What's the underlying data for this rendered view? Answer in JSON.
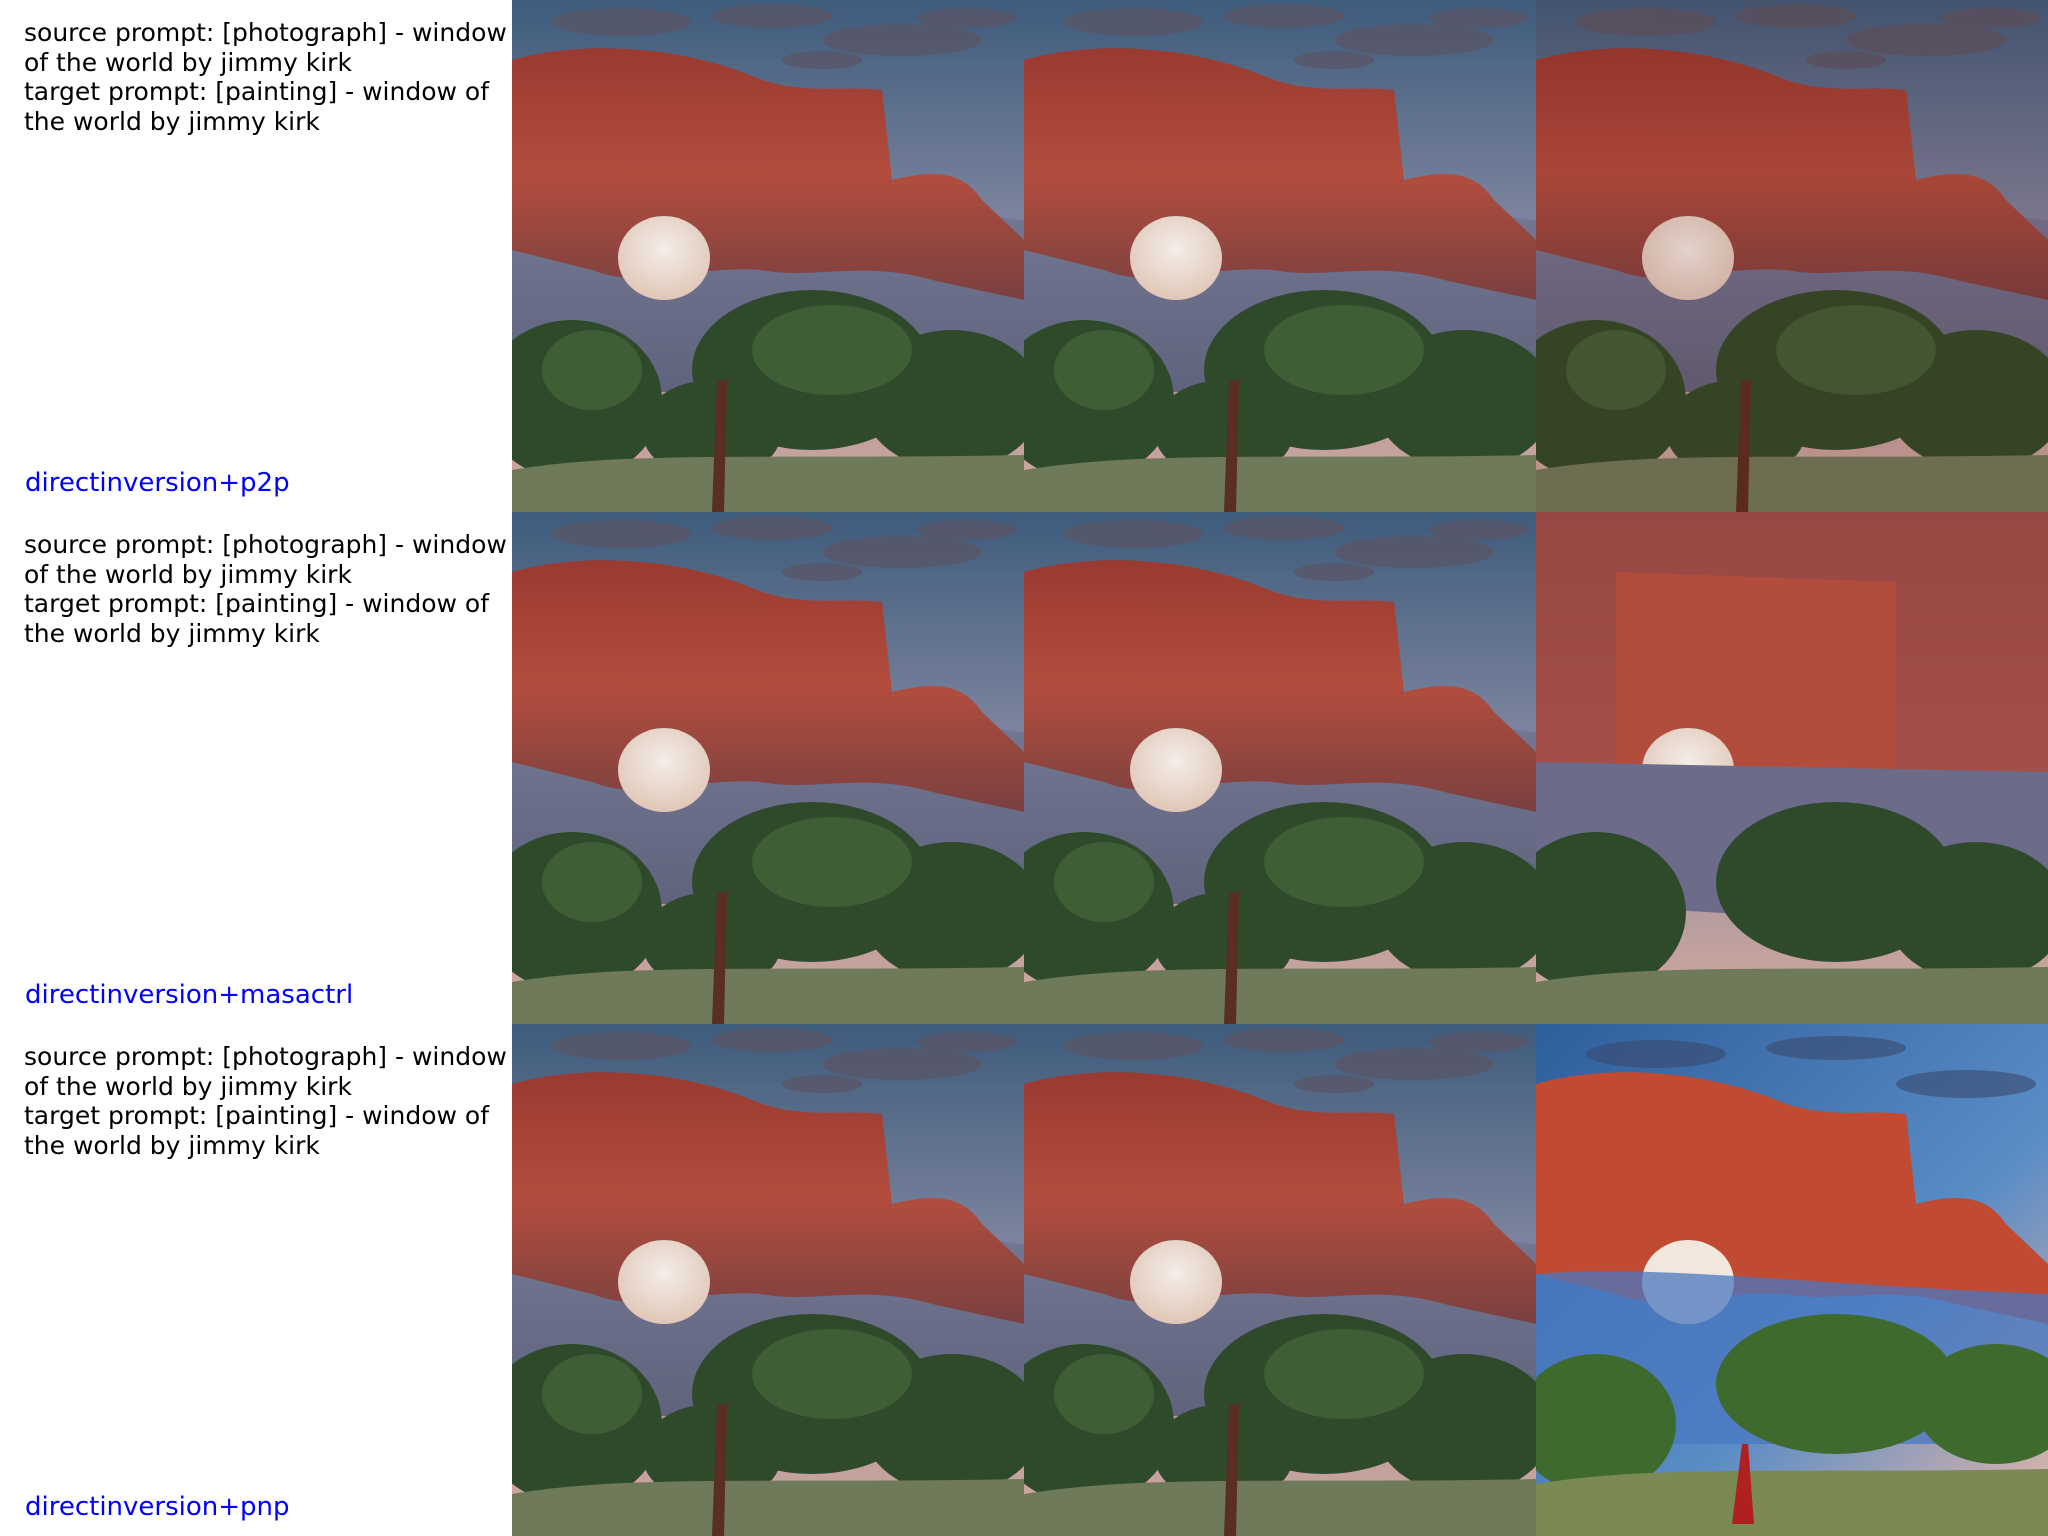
{
  "rows": [
    {
      "source_prompt": "source prompt: [photograph] - window of the world by jimmy kirk",
      "target_prompt": "target prompt: [painting] - window of the world by jimmy kirk",
      "method": "directinversion+p2p"
    },
    {
      "source_prompt": "source prompt: [photograph] - window of the world by jimmy kirk",
      "target_prompt": "target prompt: [painting] - window of the world by jimmy kirk",
      "method": "directinversion+masactrl"
    },
    {
      "source_prompt": "source prompt: [photograph] - window of the world by jimmy kirk",
      "target_prompt": "target prompt: [painting] - window of the world by jimmy kirk",
      "method": "directinversion+pnp"
    }
  ],
  "colors": {
    "method_label": "#0000ff",
    "prompt_text": "#000000",
    "rock": "#a8443a",
    "sky_top": "#3e5c7c",
    "sky_bottom": "#d9a99a",
    "foliage": "#2f4a2a"
  }
}
